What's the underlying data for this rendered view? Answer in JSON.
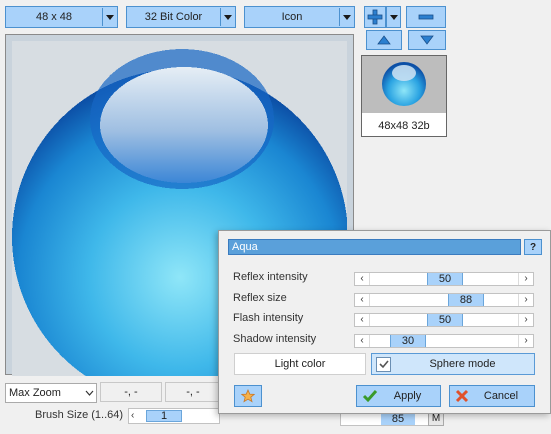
{
  "toolbar": {
    "size_select": "48 x 48",
    "color_select": "32 Bit Color",
    "type_select": "Icon"
  },
  "preview": {
    "caption": "48x48 32b"
  },
  "status": {
    "zoom_select": "Max Zoom",
    "coord_1": "-, -",
    "coord_2": "-, -",
    "brush_label": "Brush Size (1..64)",
    "brush_value": "1",
    "bottom_right_value": "85",
    "bottom_right_btn": "M"
  },
  "dialog": {
    "title": "Aqua",
    "help": "?",
    "sliders": [
      {
        "label": "Reflex intensity",
        "value": "50",
        "level": 0.5
      },
      {
        "label": "Reflex size",
        "value": "88",
        "level": 0.88
      },
      {
        "label": "Flash intensity",
        "value": "50",
        "level": 0.5
      },
      {
        "label": "Shadow intensity",
        "value": "30",
        "level": 0.3
      }
    ],
    "light_color_label": "Light color",
    "sphere_mode_label": "Sphere mode",
    "sphere_mode_checked": true,
    "apply_label": "Apply",
    "cancel_label": "Cancel"
  },
  "colors": {
    "accent_fill": "#a9d2fa",
    "accent_border": "#4c91cf",
    "title_bar": "#5aa0da"
  },
  "icons": [
    "chevron-down-icon",
    "plus-icon",
    "minus-icon",
    "arrow-up-icon",
    "arrow-down-icon",
    "star-icon",
    "checkmark-icon",
    "close-icon",
    "help-icon",
    "sphere-icon"
  ]
}
